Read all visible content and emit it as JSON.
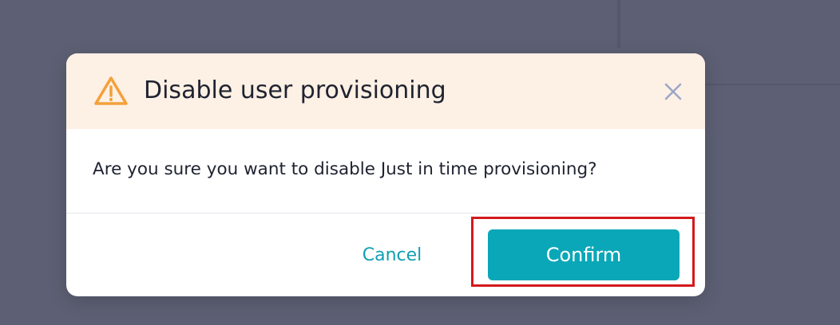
{
  "dialog": {
    "title": "Disable user provisioning",
    "message": "Are you sure you want to disable Just in time provisioning?",
    "cancel_label": "Cancel",
    "confirm_label": "Confirm",
    "icons": {
      "warning": "warning-triangle-icon",
      "close": "close-icon"
    }
  },
  "colors": {
    "header_background": "#fdf0e4",
    "warning_icon": "#f4a03a",
    "close_icon": "#9aa6c8",
    "accent": "#0aa7b8",
    "cancel_text": "#10a0b2",
    "highlight": "#d3191c",
    "overlay": "#5d6074"
  }
}
